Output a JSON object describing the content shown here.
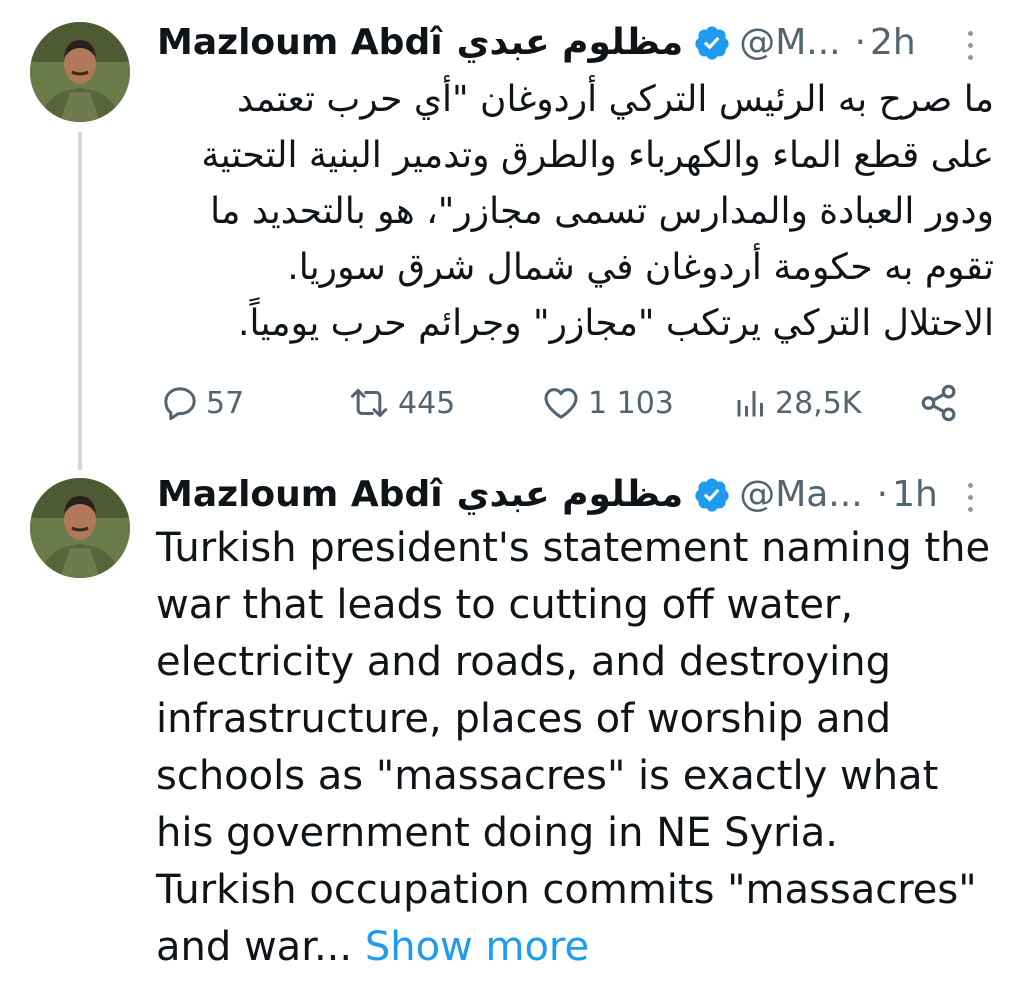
{
  "colors": {
    "text": "#0f1419",
    "secondary": "#536471",
    "link": "#1d9bf0",
    "verified": "#1d9bf0",
    "thread_line": "#cfd9de"
  },
  "tweets": [
    {
      "author_name": "Mazloum Abdî",
      "author_name_ar": "مظلوم عبدي",
      "handle": "@M...",
      "separator": "·",
      "time": "2h",
      "avatar_icon": "user-avatar-photo",
      "body_lines": [
        "ما صرح به الرئيس التركي أردوغان \"أي حرب تعتمد",
        "على قطع الماء والكهرباء والطرق وتدمير البنية التحتية",
        "ودور العبادة والمدارس تسمى مجازر\"، هو بالتحديد ما",
        "تقوم به حكومة أردوغان في شمال شرق سوريا.",
        "الاحتلال التركي يرتكب \"مجازر\" وجرائم حرب يومياً."
      ],
      "stats": {
        "replies": "57",
        "retweets": "445",
        "likes": "1 103",
        "views": "28,5K"
      }
    },
    {
      "author_name": "Mazloum Abdî",
      "author_name_ar": "مظلوم عبدي",
      "handle": "@Ma...",
      "separator": "·",
      "time": "1h",
      "avatar_icon": "user-avatar-photo",
      "body_lines": [
        "Turkish president's statement naming the",
        "war that leads to cutting off water,",
        "electricity and roads, and destroying",
        "infrastructure, places of worship and",
        "schools as \"massacres\" is exactly what",
        "his government doing in NE Syria.",
        "Turkish occupation commits \"massacres\""
      ],
      "last_line_text": "and war...",
      "show_more_label": "Show more"
    }
  ]
}
